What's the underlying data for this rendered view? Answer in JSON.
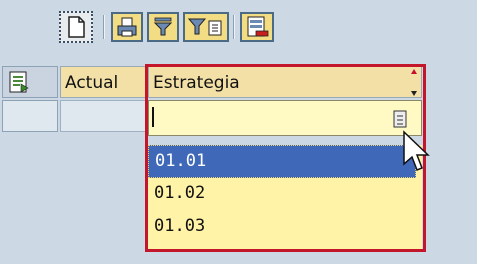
{
  "table": {
    "columns": [
      "Actual",
      "Estrategia"
    ],
    "filter_value": ""
  },
  "dropdown": {
    "options": [
      "01.01",
      "01.02",
      "01.03"
    ],
    "selected_index": 0
  },
  "colors": {
    "background": "#ccd8e3",
    "header": "#f3e0a6",
    "focus_border": "#c4162a",
    "dropdown_bg": "#fff3a8",
    "selected_option": "#3f68b8"
  },
  "icons": [
    "new-document-icon",
    "print-icon",
    "filter-icon",
    "filter-settings-icon",
    "export-icon",
    "column-settings-icon",
    "value-help-icon",
    "mouse-pointer-icon"
  ]
}
